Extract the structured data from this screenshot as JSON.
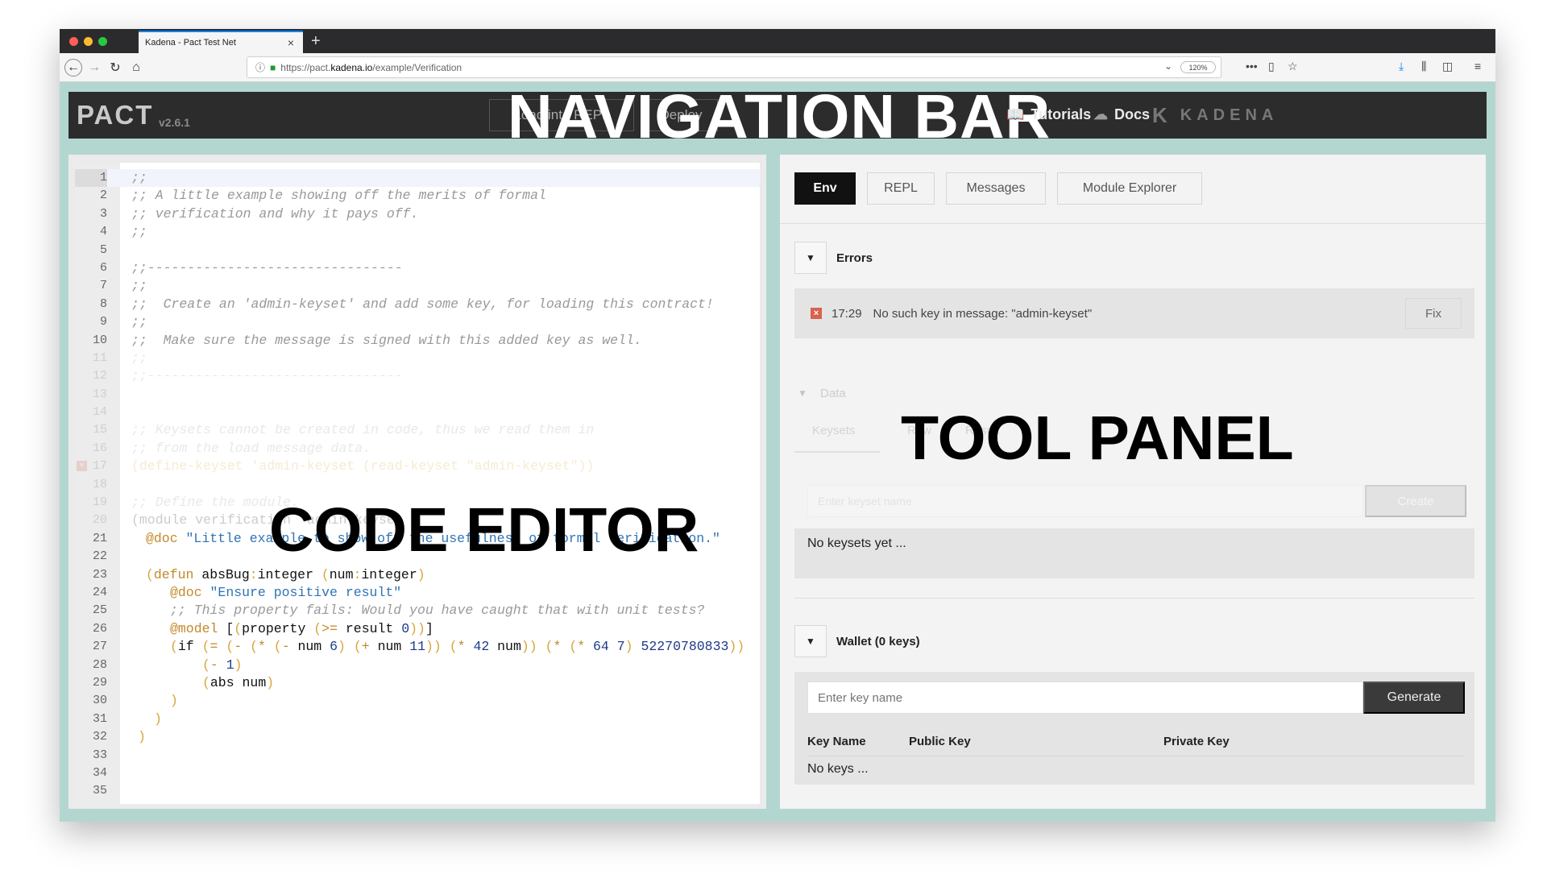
{
  "browser": {
    "tab_title": "Kadena - Pact Test Net",
    "url_prefix": "https://pact.",
    "url_domain": "kadena.io",
    "url_path": "/example/Verification",
    "zoom": "120%"
  },
  "nav": {
    "logo": "PACT",
    "version": "v2.6.1",
    "load_button": "Load into REPL",
    "deploy_button": "Deploy",
    "overlay_label": "NAVIGATION BAR",
    "tutorials": "Tutorials",
    "docs": "Docs",
    "brand": "KADENA"
  },
  "editor": {
    "overlay_label": "CODE EDITOR",
    "lines": [
      {
        "n": "1",
        "text": ";;"
      },
      {
        "n": "2",
        "text": ";; A little example showing off the merits of formal"
      },
      {
        "n": "3",
        "text": ";; verification and why it pays off."
      },
      {
        "n": "4",
        "text": ";;"
      },
      {
        "n": "5",
        "text": ""
      },
      {
        "n": "6",
        "text": ";;--------------------------------"
      },
      {
        "n": "7",
        "text": ";;"
      },
      {
        "n": "8",
        "text": ";;  Create an 'admin-keyset' and add some key, for loading this contract!"
      },
      {
        "n": "9",
        "text": ";;"
      },
      {
        "n": "10",
        "text": ";;  Make sure the message is signed with this added key as well."
      },
      {
        "n": "11",
        "text": ";;"
      },
      {
        "n": "12",
        "text": ";;--------------------------------"
      },
      {
        "n": "13",
        "text": ""
      },
      {
        "n": "14",
        "text": ""
      },
      {
        "n": "15",
        "text": ";; Keysets cannot be created in code, thus we read them in"
      },
      {
        "n": "16",
        "text": ";; from the load message data."
      },
      {
        "n": "17",
        "text": "(define-keyset 'admin-keyset (read-keyset \"admin-keyset\"))"
      },
      {
        "n": "18",
        "text": ""
      },
      {
        "n": "19",
        "text": ";; Define the module."
      },
      {
        "n": "20",
        "text": "(module verification 'admin-keyset"
      },
      {
        "n": "21",
        "text": ""
      },
      {
        "n": "22",
        "text": ""
      },
      {
        "n": "23",
        "text": ""
      },
      {
        "n": "24",
        "text": ""
      },
      {
        "n": "25",
        "text": ""
      },
      {
        "n": "26",
        "text": ""
      },
      {
        "n": "27",
        "text": ""
      },
      {
        "n": "28",
        "text": ""
      },
      {
        "n": "29",
        "text": ""
      },
      {
        "n": "30",
        "text": ""
      },
      {
        "n": "31",
        "text": ""
      },
      {
        "n": "32",
        "text": ""
      },
      {
        "n": "33",
        "text": ""
      },
      {
        "n": "34",
        "text": ""
      },
      {
        "n": "35",
        "text": ""
      }
    ],
    "code": {
      "doc_kw": "@doc",
      "doc_str": "\"Little example to show off the usefulness of formal verification.\"",
      "defun": "defun",
      "fn_name": "absBug",
      "colon": ":",
      "type_int": "integer",
      "arg": "num",
      "doc2_str": "\"Ensure positive result\"",
      "comment25": ";; This property fails: Would you have caught that with unit tests?",
      "model_kw": "@model",
      "property": "property",
      "gte": ">=",
      "result": "result",
      "zero": "0",
      "if_kw": "if",
      "eq": "=",
      "minus": "-",
      "star": "*",
      "plus": "+",
      "six": "6",
      "eleven": "11",
      "fortytwo": "42",
      "sixtyfour": "64",
      "seven": "7",
      "bignum": "52270780833",
      "one": "1",
      "abs": "abs"
    }
  },
  "panel": {
    "overlay_label": "TOOL PANEL",
    "tabs": [
      "Env",
      "REPL",
      "Messages",
      "Module Explorer"
    ],
    "errors_title": "Errors",
    "error_time": "17:29",
    "error_msg": "No such key in message: \"admin-keyset\"",
    "fix_label": "Fix",
    "data_title": "Data",
    "data_tabs": [
      "Keysets",
      "Raw",
      "Result"
    ],
    "keyset_placeholder": "Enter keyset name",
    "create_label": "Create",
    "no_keysets": "No keysets yet ...",
    "wallet_title": "Wallet (0 keys)",
    "key_placeholder": "Enter key name",
    "generate_label": "Generate",
    "col_key_name": "Key Name",
    "col_public": "Public Key",
    "col_private": "Private Key",
    "no_keys": "No keys ..."
  }
}
